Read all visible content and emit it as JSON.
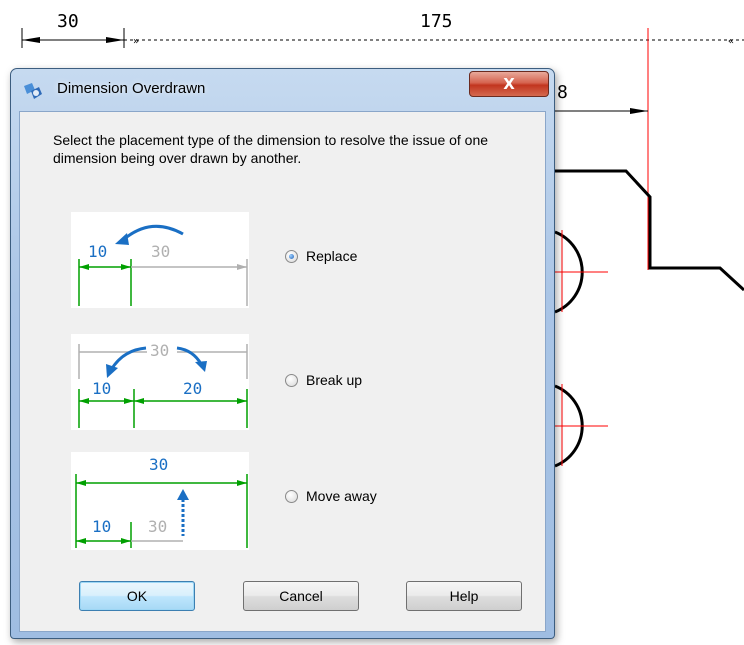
{
  "drawing": {
    "dim_left": "30",
    "dim_top": "175",
    "dim_right_partial": "8"
  },
  "dialog": {
    "title": "Dimension Overdrawn",
    "close_label": "X",
    "instruction": "Select the placement type of the dimension to resolve the issue of one dimension being over drawn by another.",
    "options": [
      {
        "label": "Replace",
        "checked": true,
        "diagram": {
          "a": "10",
          "b": "30"
        }
      },
      {
        "label": "Break up",
        "checked": false,
        "diagram": {
          "top": "30",
          "a": "10",
          "b": "20"
        }
      },
      {
        "label": "Move away",
        "checked": false,
        "diagram": {
          "top": "30",
          "a": "10",
          "b": "30"
        }
      }
    ],
    "buttons": {
      "ok": "OK",
      "cancel": "Cancel",
      "help": "Help"
    }
  },
  "colors": {
    "dimension_green": "#00a000",
    "dimension_blue": "#1a6fc4",
    "gray": "#b0b0b0",
    "red": "#ff0000"
  }
}
